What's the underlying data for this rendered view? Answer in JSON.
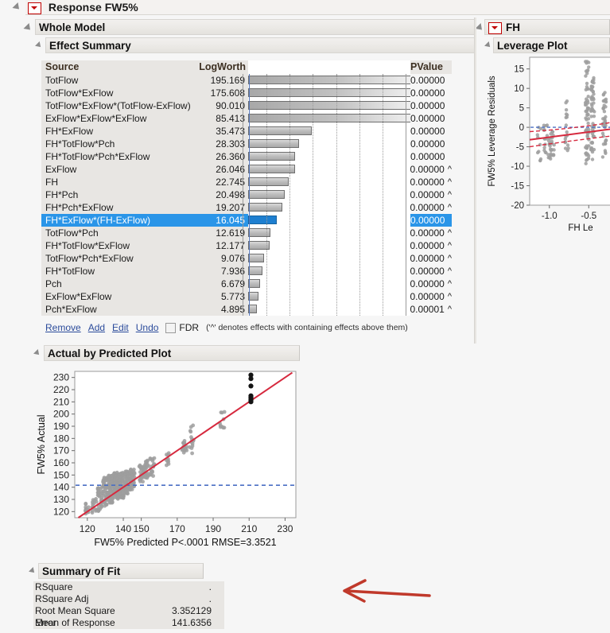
{
  "window": {
    "response_title": "Response FW5%",
    "whole_model": "Whole Model",
    "effect_summary": "Effect Summary",
    "fh_title": "FH",
    "leverage_plot": "Leverage Plot",
    "actual_by_predicted": "Actual by Predicted Plot",
    "summary_of_fit": "Summary of Fit"
  },
  "effect_summary": {
    "columns": [
      "Source",
      "LogWorth",
      "PValue"
    ],
    "selected_index": 11,
    "max_logworth": 195.169,
    "bar_axis_max": 100,
    "rows": [
      {
        "source": "TotFlow",
        "logworth": "195.169",
        "pvalue": "0.00000",
        "caret": "",
        "bar": 195.169,
        "clipped": true
      },
      {
        "source": "TotFlow*ExFlow",
        "logworth": "175.608",
        "pvalue": "0.00000",
        "caret": "",
        "bar": 175.608,
        "clipped": true
      },
      {
        "source": "TotFlow*ExFlow*(TotFlow-ExFlow)",
        "logworth": "90.010",
        "pvalue": "0.00000",
        "caret": "",
        "bar": 90.01,
        "clipped": true
      },
      {
        "source": "ExFlow*ExFlow*ExFlow",
        "logworth": "85.413",
        "pvalue": "0.00000",
        "caret": "",
        "bar": 85.413,
        "clipped": true
      },
      {
        "source": "FH*ExFlow",
        "logworth": "35.473",
        "pvalue": "0.00000",
        "caret": "",
        "bar": 35.473,
        "clipped": false
      },
      {
        "source": "FH*TotFlow*Pch",
        "logworth": "28.303",
        "pvalue": "0.00000",
        "caret": "",
        "bar": 28.303,
        "clipped": false
      },
      {
        "source": "FH*TotFlow*Pch*ExFlow",
        "logworth": "26.360",
        "pvalue": "0.00000",
        "caret": "",
        "bar": 26.36,
        "clipped": false
      },
      {
        "source": "ExFlow",
        "logworth": "26.046",
        "pvalue": "0.00000",
        "caret": "^",
        "bar": 26.046,
        "clipped": false
      },
      {
        "source": "FH",
        "logworth": "22.745",
        "pvalue": "0.00000",
        "caret": "^",
        "bar": 22.745,
        "clipped": false
      },
      {
        "source": "FH*Pch",
        "logworth": "20.498",
        "pvalue": "0.00000",
        "caret": "^",
        "bar": 20.498,
        "clipped": false
      },
      {
        "source": "FH*Pch*ExFlow",
        "logworth": "19.207",
        "pvalue": "0.00000",
        "caret": "^",
        "bar": 19.207,
        "clipped": false
      },
      {
        "source": "FH*ExFlow*(FH-ExFlow)",
        "logworth": "16.045",
        "pvalue": "0.00000",
        "caret": "",
        "bar": 16.045,
        "clipped": false
      },
      {
        "source": "TotFlow*Pch",
        "logworth": "12.619",
        "pvalue": "0.00000",
        "caret": "^",
        "bar": 12.619,
        "clipped": false
      },
      {
        "source": "FH*TotFlow*ExFlow",
        "logworth": "12.177",
        "pvalue": "0.00000",
        "caret": "^",
        "bar": 12.177,
        "clipped": false
      },
      {
        "source": "TotFlow*Pch*ExFlow",
        "logworth": "9.076",
        "pvalue": "0.00000",
        "caret": "^",
        "bar": 9.076,
        "clipped": false
      },
      {
        "source": "FH*TotFlow",
        "logworth": "7.936",
        "pvalue": "0.00000",
        "caret": "^",
        "bar": 7.936,
        "clipped": false
      },
      {
        "source": "Pch",
        "logworth": "6.679",
        "pvalue": "0.00000",
        "caret": "^",
        "bar": 6.679,
        "clipped": false
      },
      {
        "source": "ExFlow*ExFlow",
        "logworth": "5.773",
        "pvalue": "0.00000",
        "caret": "^",
        "bar": 5.773,
        "clipped": false
      },
      {
        "source": "Pch*ExFlow",
        "logworth": "4.895",
        "pvalue": "0.00001",
        "caret": "^",
        "bar": 4.895,
        "clipped": false
      }
    ]
  },
  "actions": {
    "remove": "Remove",
    "add": "Add",
    "edit": "Edit",
    "undo": "Undo",
    "fdr": "FDR",
    "note": "('^' denotes effects with containing effects above them)"
  },
  "summary_of_fit": {
    "rows": [
      {
        "label": "RSquare",
        "value": "."
      },
      {
        "label": "RSquare Adj",
        "value": "."
      },
      {
        "label": "Root Mean Square Error",
        "value": "3.352129"
      },
      {
        "label": "Mean of Response",
        "value": "141.6356"
      }
    ]
  },
  "colors": {
    "selection_blue": "#2a95e8",
    "fit_line_red": "#d6293e",
    "mean_line_blue": "#4a6fc4",
    "point_gray": "#9e9e9e",
    "point_black": "#141414",
    "header_tan": "#e8e6e3"
  },
  "chart_data": [
    {
      "type": "scatter",
      "name": "actual-by-predicted-plot",
      "title": "Actual by Predicted Plot",
      "xlabel": "FW5% Predicted P<.0001 RMSE=3.3521",
      "ylabel": "FW5% Actual",
      "xlim": [
        113,
        236
      ],
      "ylim": [
        115,
        235
      ],
      "xticks": [
        120,
        140,
        150,
        170,
        190,
        210,
        230
      ],
      "yticks": [
        120,
        130,
        140,
        150,
        160,
        170,
        180,
        190,
        200,
        210,
        220,
        230
      ],
      "grid": false,
      "annotations": [
        {
          "kind": "identity-line",
          "color": "#d6293e",
          "label": "fit line y=x"
        },
        {
          "kind": "mean-line",
          "orientation": "horizontal",
          "value": 141.6356,
          "color": "#4a6fc4",
          "style": "dashed"
        }
      ],
      "series": [
        {
          "name": "observations",
          "color": "#9e9e9e",
          "note": "dense cluster 118-160 predicted, sparse above",
          "clusters": [
            {
              "x": 120,
              "y_low": 118,
              "y_high": 128,
              "n": 12
            },
            {
              "x": 124,
              "y_low": 119,
              "y_high": 132,
              "n": 14
            },
            {
              "x": 127,
              "y_low": 120,
              "y_high": 140,
              "n": 30
            },
            {
              "x": 130,
              "y_low": 124,
              "y_high": 148,
              "n": 55
            },
            {
              "x": 133,
              "y_low": 127,
              "y_high": 150,
              "n": 70
            },
            {
              "x": 136,
              "y_low": 130,
              "y_high": 152,
              "n": 80
            },
            {
              "x": 139,
              "y_low": 131,
              "y_high": 152,
              "n": 75
            },
            {
              "x": 142,
              "y_low": 134,
              "y_high": 153,
              "n": 60
            },
            {
              "x": 145,
              "y_low": 137,
              "y_high": 155,
              "n": 45
            },
            {
              "x": 150,
              "y_low": 144,
              "y_high": 158,
              "n": 30
            },
            {
              "x": 153,
              "y_low": 147,
              "y_high": 162,
              "n": 25
            },
            {
              "x": 156,
              "y_low": 149,
              "y_high": 164,
              "n": 18
            },
            {
              "x": 165,
              "y_low": 158,
              "y_high": 168,
              "n": 10
            },
            {
              "x": 174,
              "y_low": 168,
              "y_high": 178,
              "n": 16
            },
            {
              "x": 178,
              "y_low": 167,
              "y_high": 192,
              "n": 14
            },
            {
              "x": 195,
              "y_low": 187,
              "y_high": 202,
              "n": 10
            }
          ]
        },
        {
          "name": "highlighted-observations",
          "color": "#141414",
          "points": [
            {
              "x": 211,
              "y": 210
            },
            {
              "x": 211,
              "y": 211
            },
            {
              "x": 211,
              "y": 212
            },
            {
              "x": 211,
              "y": 213
            },
            {
              "x": 211,
              "y": 214
            },
            {
              "x": 211,
              "y": 215
            },
            {
              "x": 211,
              "y": 223
            },
            {
              "x": 211,
              "y": 229
            },
            {
              "x": 211,
              "y": 232
            }
          ]
        }
      ]
    },
    {
      "type": "scatter",
      "name": "fh-leverage-plot",
      "title": "Leverage Plot",
      "xlabel": "FH Le",
      "ylabel": "FW5% Leverage Residuals",
      "xlim": [
        -1.25,
        -0.2
      ],
      "ylim": [
        -20,
        18
      ],
      "xticks": [
        -1.0,
        -0.5
      ],
      "yticks": [
        -20,
        -15,
        -10,
        -5,
        0,
        5,
        10,
        15
      ],
      "grid": false,
      "annotations": [
        {
          "kind": "fit-line",
          "color": "#d6293e",
          "style": "solid"
        },
        {
          "kind": "confidence-band",
          "color": "#d6293e",
          "style": "dashed"
        },
        {
          "kind": "mean-line",
          "orientation": "horizontal",
          "value": 0,
          "color": "#4a6fc4",
          "style": "dashed"
        }
      ],
      "series": [
        {
          "name": "leverage-residuals",
          "color": "#9e9e9e",
          "clusters": [
            {
              "x": -1.13,
              "y_low": -9,
              "y_high": 1,
              "n": 10
            },
            {
              "x": -1.05,
              "y_low": -8,
              "y_high": 1,
              "n": 14
            },
            {
              "x": -1.0,
              "y_low": -9,
              "y_high": 0,
              "n": 16
            },
            {
              "x": -0.96,
              "y_low": -8,
              "y_high": -1,
              "n": 12
            },
            {
              "x": -0.78,
              "y_low": -6,
              "y_high": 7,
              "n": 18
            },
            {
              "x": -0.52,
              "y_low": -11,
              "y_high": 17,
              "n": 60
            },
            {
              "x": -0.45,
              "y_low": -9,
              "y_high": 13,
              "n": 55
            },
            {
              "x": -0.3,
              "y_low": -8,
              "y_high": 9,
              "n": 40
            }
          ]
        }
      ]
    }
  ]
}
